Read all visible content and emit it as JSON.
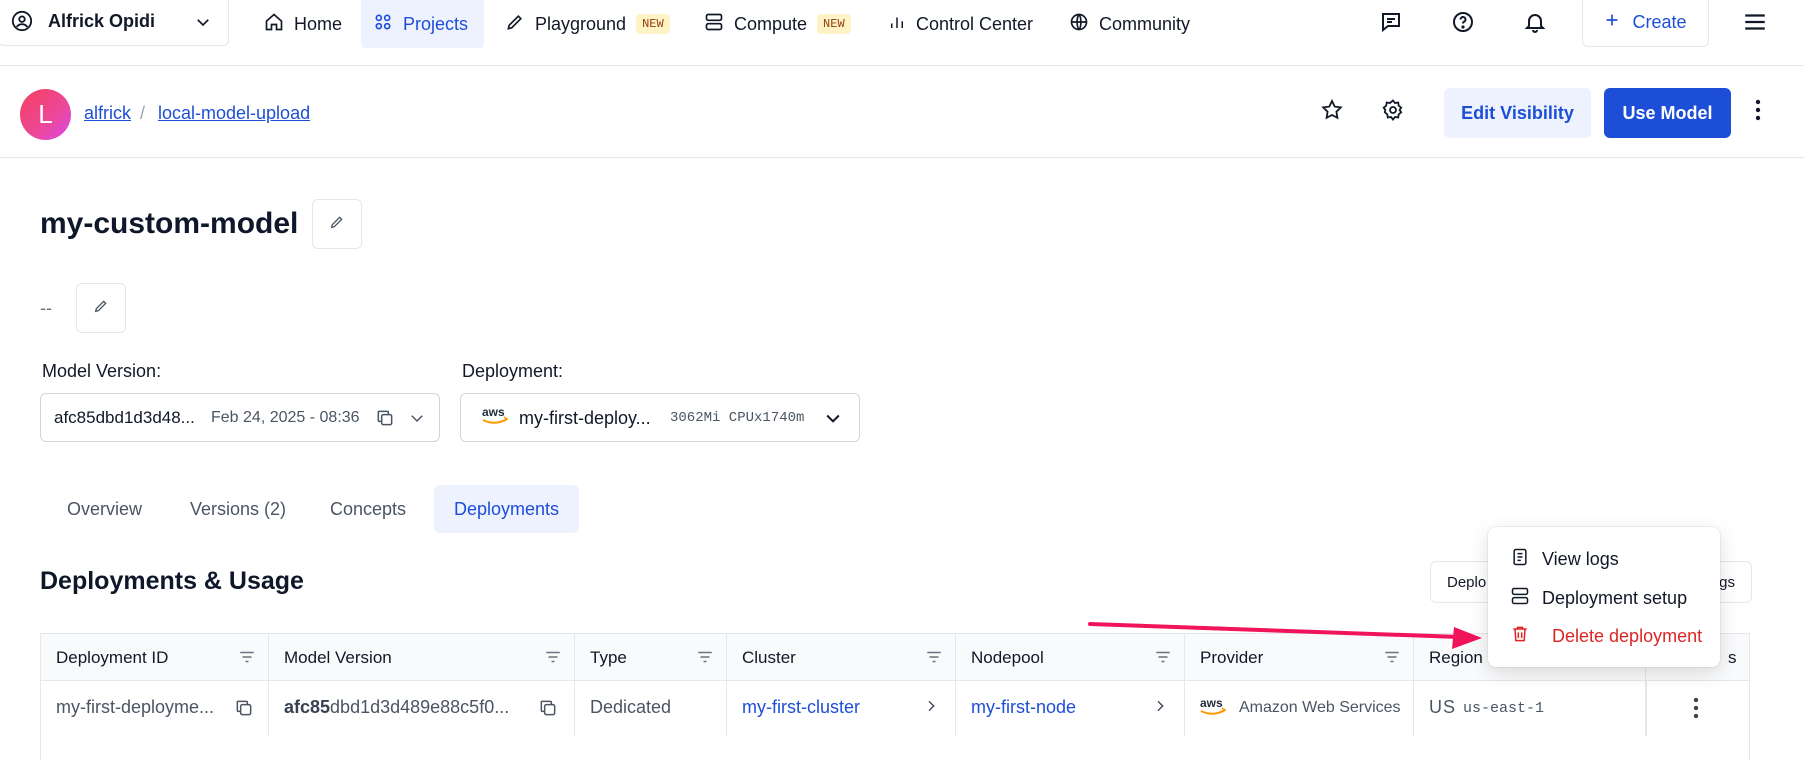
{
  "nav": {
    "user_name": "Alfrick Opidi",
    "items": [
      {
        "label": "Home"
      },
      {
        "label": "Projects"
      },
      {
        "label": "Playground",
        "badge": "NEW"
      },
      {
        "label": "Compute",
        "badge": "NEW"
      },
      {
        "label": "Control Center"
      },
      {
        "label": "Community"
      }
    ],
    "create_label": "Create"
  },
  "header": {
    "avatar_letter": "L",
    "breadcrumb": [
      "alfrick",
      "local-model-upload"
    ],
    "edit_visibility_label": "Edit Visibility",
    "use_model_label": "Use Model"
  },
  "model": {
    "name": "my-custom-model",
    "description": "--"
  },
  "model_version": {
    "label": "Model Version:",
    "id": "afc85dbd1d3d48...",
    "date": "Feb 24, 2025 - 08:36"
  },
  "deployment": {
    "label": "Deployment:",
    "provider_logo": "aws",
    "name": "my-first-deploy...",
    "spec": "3062Mi CPUx1740m"
  },
  "tabs": [
    {
      "label": "Overview"
    },
    {
      "label": "Versions (2)"
    },
    {
      "label": "Concepts"
    },
    {
      "label": "Deployments"
    }
  ],
  "section": {
    "title": "Deployments & Usage",
    "btn_left_fragment": "Deplo",
    "btn_right_fragment": "gs"
  },
  "table": {
    "columns": [
      "Deployment ID",
      "Model Version",
      "Type",
      "Cluster",
      "Nodepool",
      "Provider",
      "Region",
      "s"
    ],
    "row": {
      "deployment_id": "my-first-deployme...",
      "model_version_bold": "afc85",
      "model_version_rest": "dbd1d3d489e88c5f0...",
      "type": "Dedicated",
      "cluster": "my-first-cluster",
      "nodepool": "my-first-node",
      "provider_logo": "aws",
      "provider": "Amazon Web Services",
      "region_country": "US",
      "region": "us-east-1"
    }
  },
  "menu": {
    "items": [
      {
        "label": "View logs",
        "icon": "file-icon"
      },
      {
        "label": "Deployment setup",
        "icon": "server-icon"
      },
      {
        "label": "Delete deployment",
        "icon": "trash-icon"
      }
    ],
    "danger_color": "#dc2626"
  },
  "colors": {
    "accent": "#1d4ed8",
    "arrow": "#f0145a"
  }
}
